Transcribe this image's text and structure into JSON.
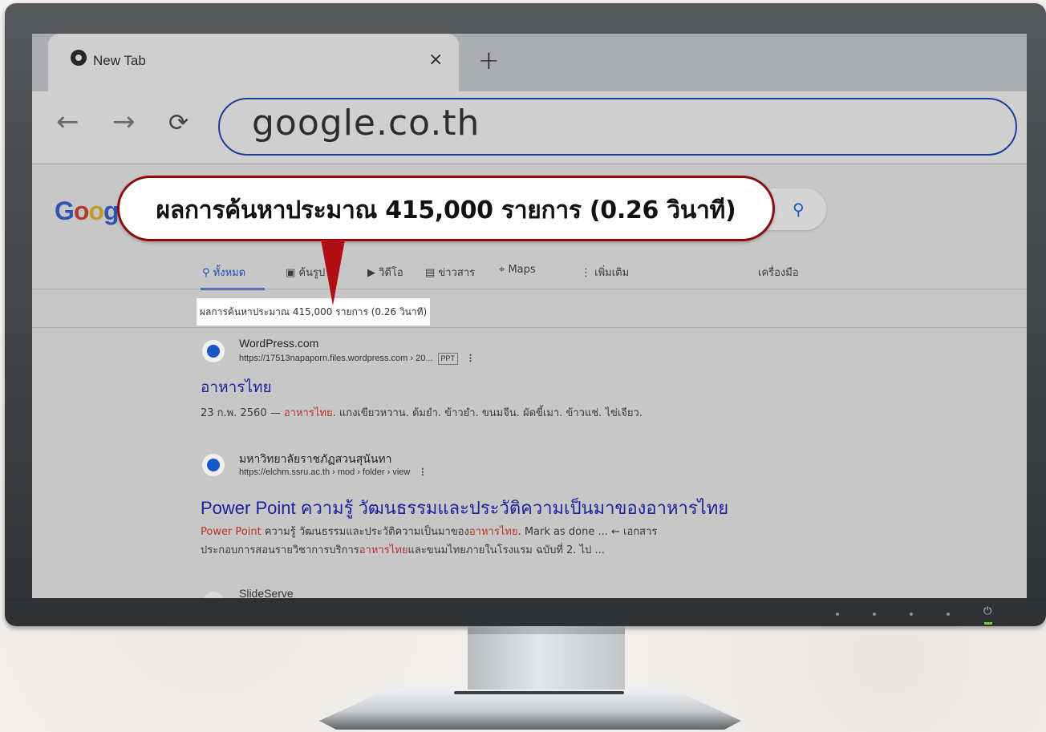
{
  "browser": {
    "tab": {
      "title": "New Tab",
      "close": "×"
    },
    "new_tab": "+",
    "nav": {
      "back": "←",
      "forward": "→",
      "reload": "C"
    },
    "address": "google.co.th"
  },
  "google": {
    "logo_letters": [
      "G",
      "o",
      "o",
      "g"
    ],
    "search_icon": "⚲",
    "tabs": [
      {
        "label": "ทั้งหมด",
        "icon": "search-icon",
        "active": true
      },
      {
        "label": "ค้นรูป",
        "icon": "image-icon",
        "active": false
      },
      {
        "label": "วิดีโอ",
        "icon": "play-icon",
        "active": false
      },
      {
        "label": "ข่าวสาร",
        "icon": "news-icon",
        "active": false
      },
      {
        "label": "Maps",
        "icon": "map-pin-icon",
        "active": false
      },
      {
        "label": "เพิ่มเติม",
        "icon": "more-icon",
        "active": false
      }
    ],
    "tools": "เครื่องมือ",
    "stats": "ผลการค้นหาประมาณ 415,000 รายการ (0.26 วินาที)"
  },
  "results": [
    {
      "site": "WordPress.com",
      "url": "https://17513napaporn.files.wordpress.com › 20...",
      "badge": "PPT",
      "title": "อาหารไทย",
      "snippet_pre": "23 ก.พ. 2560 — ",
      "snippet_hl": "อาหารไทย",
      "snippet_post": ". แกงเขียวหวาน. ต้มยำ. ข้าวยำ. ขนมจีน. ผัดขี้เมา. ข้าวแช่. ไข่เจียว."
    },
    {
      "site": "มหาวิทยาลัยราชภัฏสวนสุนันทา",
      "url": "https://elchm.ssru.ac.th › mod › folder › view",
      "title": "Power Point ความรู้ วัฒนธรรมและประวัติความเป็นมาของอาหารไทย",
      "snippet_hl1": "Power Point",
      "snippet_1": " ความรู้ วัฒนธรรมและประวัติความเป็นมาของ",
      "snippet_hl2": "อาหารไทย",
      "snippet_2": ". Mark as done ... ← เอกสาร",
      "snippet_3": "ประกอบการสอนรายวิชาการบริการ",
      "snippet_hl3": "อาหารไทย",
      "snippet_4": "และขนมไทยภายในโรงแรม ฉบับที่ 2. ไป ..."
    },
    {
      "site": "SlideServe"
    }
  ],
  "callout": {
    "text": "ผลการค้นหาประมาณ 415,000 รายการ (0.26 วินาที)"
  },
  "colors": {
    "callout_border": "#8a0a0a",
    "pointer": "#b00e12",
    "link": "#1b239e",
    "highlight": "#b8332d"
  }
}
